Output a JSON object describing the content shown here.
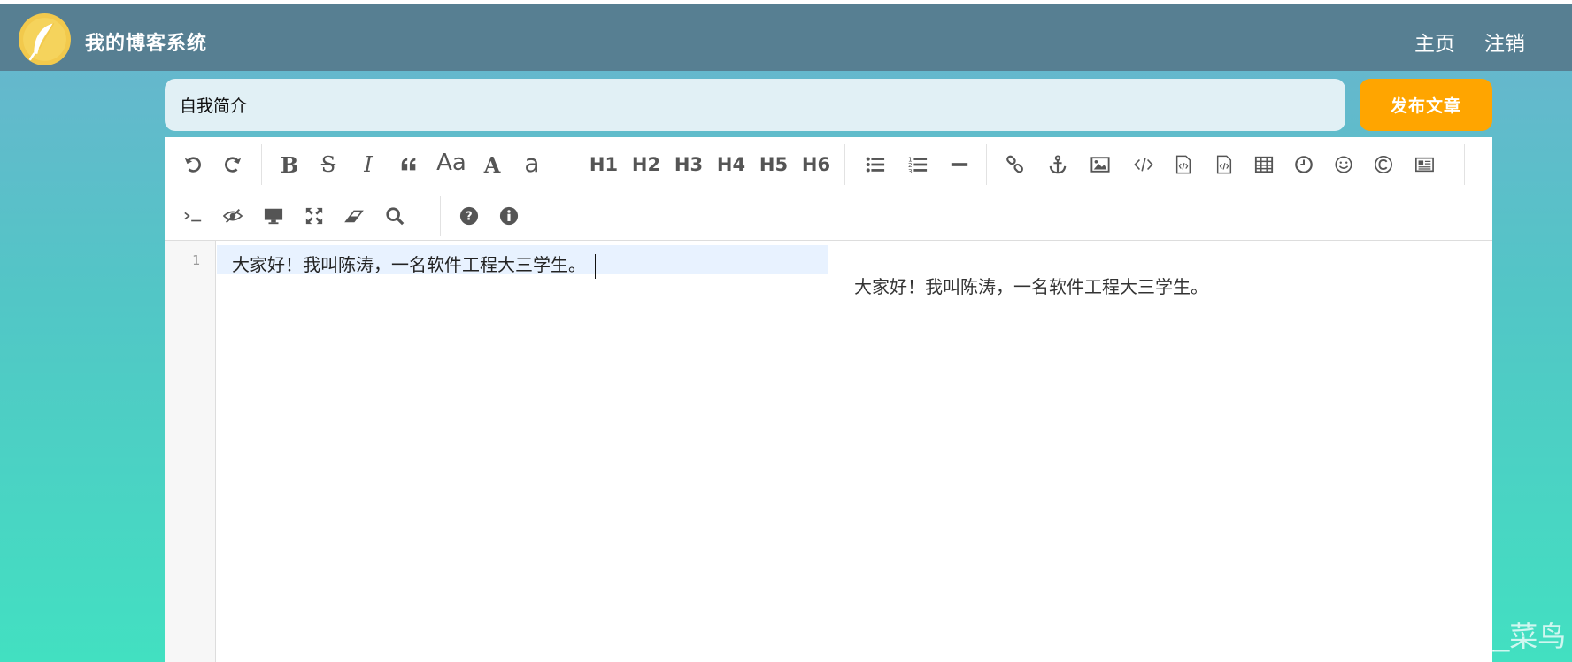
{
  "header": {
    "site_title": "我的博客系统",
    "nav": {
      "home": "主页",
      "logout": "注销"
    },
    "logo_icon": "feather-icon"
  },
  "article": {
    "title_value": "自我简介",
    "publish_label": "发布文章"
  },
  "toolbar": {
    "row1": [
      {
        "name": "undo-icon"
      },
      {
        "name": "redo-icon"
      },
      {
        "name": "bold-icon",
        "text": "B"
      },
      {
        "name": "strikethrough-icon",
        "text": "S"
      },
      {
        "name": "italic-icon",
        "text": "I"
      },
      {
        "name": "quote-icon"
      },
      {
        "name": "uppercase-icon",
        "text": "Aa"
      },
      {
        "name": "uppercase-first-icon",
        "text": "A"
      },
      {
        "name": "lowercase-icon",
        "text": "a"
      },
      {
        "name": "h1-button",
        "text": "H1"
      },
      {
        "name": "h2-button",
        "text": "H2"
      },
      {
        "name": "h3-button",
        "text": "H3"
      },
      {
        "name": "h4-button",
        "text": "H4"
      },
      {
        "name": "h5-button",
        "text": "H5"
      },
      {
        "name": "h6-button",
        "text": "H6"
      },
      {
        "name": "unordered-list-icon"
      },
      {
        "name": "ordered-list-icon"
      },
      {
        "name": "horizontal-rule-icon"
      },
      {
        "name": "link-icon"
      },
      {
        "name": "anchor-icon"
      },
      {
        "name": "image-icon"
      },
      {
        "name": "code-icon"
      },
      {
        "name": "code-block-icon"
      },
      {
        "name": "preformatted-icon"
      },
      {
        "name": "table-icon"
      },
      {
        "name": "datetime-icon"
      },
      {
        "name": "emoji-icon"
      },
      {
        "name": "html-entities-icon"
      },
      {
        "name": "pagebreak-icon"
      }
    ],
    "row2": [
      {
        "name": "goto-line-icon"
      },
      {
        "name": "watch-toggle-icon"
      },
      {
        "name": "preview-icon"
      },
      {
        "name": "fullscreen-icon"
      },
      {
        "name": "clear-icon"
      },
      {
        "name": "search-icon"
      },
      {
        "name": "help-icon"
      },
      {
        "name": "info-icon"
      }
    ]
  },
  "editor": {
    "line_number": "1",
    "content": "大家好！我叫陈涛，一名软件工程大三学生。"
  },
  "preview": {
    "content": "大家好！我叫陈涛，一名软件工程大三学生。"
  },
  "watermark": "CSDN @Java__菜鸟",
  "colors": {
    "navbar": "#577f92",
    "publish": "#ffa500",
    "title_input_bg": "#e1f0f5",
    "active_line": "#e8f2ff"
  }
}
